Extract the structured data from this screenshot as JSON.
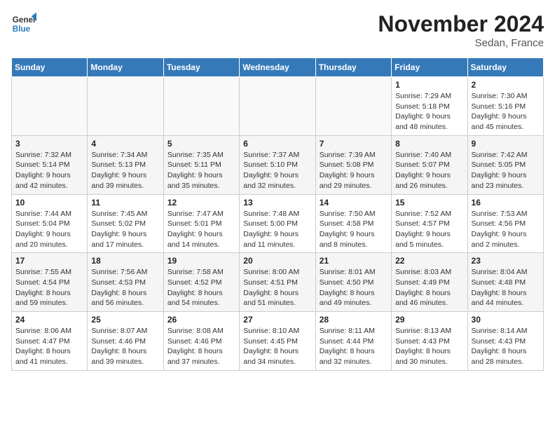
{
  "header": {
    "logo_general": "General",
    "logo_blue": "Blue",
    "month_title": "November 2024",
    "location": "Sedan, France"
  },
  "weekdays": [
    "Sunday",
    "Monday",
    "Tuesday",
    "Wednesday",
    "Thursday",
    "Friday",
    "Saturday"
  ],
  "weeks": [
    [
      {
        "day": "",
        "detail": ""
      },
      {
        "day": "",
        "detail": ""
      },
      {
        "day": "",
        "detail": ""
      },
      {
        "day": "",
        "detail": ""
      },
      {
        "day": "",
        "detail": ""
      },
      {
        "day": "1",
        "detail": "Sunrise: 7:29 AM\nSunset: 5:18 PM\nDaylight: 9 hours and 48 minutes."
      },
      {
        "day": "2",
        "detail": "Sunrise: 7:30 AM\nSunset: 5:16 PM\nDaylight: 9 hours and 45 minutes."
      }
    ],
    [
      {
        "day": "3",
        "detail": "Sunrise: 7:32 AM\nSunset: 5:14 PM\nDaylight: 9 hours and 42 minutes."
      },
      {
        "day": "4",
        "detail": "Sunrise: 7:34 AM\nSunset: 5:13 PM\nDaylight: 9 hours and 39 minutes."
      },
      {
        "day": "5",
        "detail": "Sunrise: 7:35 AM\nSunset: 5:11 PM\nDaylight: 9 hours and 35 minutes."
      },
      {
        "day": "6",
        "detail": "Sunrise: 7:37 AM\nSunset: 5:10 PM\nDaylight: 9 hours and 32 minutes."
      },
      {
        "day": "7",
        "detail": "Sunrise: 7:39 AM\nSunset: 5:08 PM\nDaylight: 9 hours and 29 minutes."
      },
      {
        "day": "8",
        "detail": "Sunrise: 7:40 AM\nSunset: 5:07 PM\nDaylight: 9 hours and 26 minutes."
      },
      {
        "day": "9",
        "detail": "Sunrise: 7:42 AM\nSunset: 5:05 PM\nDaylight: 9 hours and 23 minutes."
      }
    ],
    [
      {
        "day": "10",
        "detail": "Sunrise: 7:44 AM\nSunset: 5:04 PM\nDaylight: 9 hours and 20 minutes."
      },
      {
        "day": "11",
        "detail": "Sunrise: 7:45 AM\nSunset: 5:02 PM\nDaylight: 9 hours and 17 minutes."
      },
      {
        "day": "12",
        "detail": "Sunrise: 7:47 AM\nSunset: 5:01 PM\nDaylight: 9 hours and 14 minutes."
      },
      {
        "day": "13",
        "detail": "Sunrise: 7:48 AM\nSunset: 5:00 PM\nDaylight: 9 hours and 11 minutes."
      },
      {
        "day": "14",
        "detail": "Sunrise: 7:50 AM\nSunset: 4:58 PM\nDaylight: 9 hours and 8 minutes."
      },
      {
        "day": "15",
        "detail": "Sunrise: 7:52 AM\nSunset: 4:57 PM\nDaylight: 9 hours and 5 minutes."
      },
      {
        "day": "16",
        "detail": "Sunrise: 7:53 AM\nSunset: 4:56 PM\nDaylight: 9 hours and 2 minutes."
      }
    ],
    [
      {
        "day": "17",
        "detail": "Sunrise: 7:55 AM\nSunset: 4:54 PM\nDaylight: 8 hours and 59 minutes."
      },
      {
        "day": "18",
        "detail": "Sunrise: 7:56 AM\nSunset: 4:53 PM\nDaylight: 8 hours and 56 minutes."
      },
      {
        "day": "19",
        "detail": "Sunrise: 7:58 AM\nSunset: 4:52 PM\nDaylight: 8 hours and 54 minutes."
      },
      {
        "day": "20",
        "detail": "Sunrise: 8:00 AM\nSunset: 4:51 PM\nDaylight: 8 hours and 51 minutes."
      },
      {
        "day": "21",
        "detail": "Sunrise: 8:01 AM\nSunset: 4:50 PM\nDaylight: 8 hours and 49 minutes."
      },
      {
        "day": "22",
        "detail": "Sunrise: 8:03 AM\nSunset: 4:49 PM\nDaylight: 8 hours and 46 minutes."
      },
      {
        "day": "23",
        "detail": "Sunrise: 8:04 AM\nSunset: 4:48 PM\nDaylight: 8 hours and 44 minutes."
      }
    ],
    [
      {
        "day": "24",
        "detail": "Sunrise: 8:06 AM\nSunset: 4:47 PM\nDaylight: 8 hours and 41 minutes."
      },
      {
        "day": "25",
        "detail": "Sunrise: 8:07 AM\nSunset: 4:46 PM\nDaylight: 8 hours and 39 minutes."
      },
      {
        "day": "26",
        "detail": "Sunrise: 8:08 AM\nSunset: 4:46 PM\nDaylight: 8 hours and 37 minutes."
      },
      {
        "day": "27",
        "detail": "Sunrise: 8:10 AM\nSunset: 4:45 PM\nDaylight: 8 hours and 34 minutes."
      },
      {
        "day": "28",
        "detail": "Sunrise: 8:11 AM\nSunset: 4:44 PM\nDaylight: 8 hours and 32 minutes."
      },
      {
        "day": "29",
        "detail": "Sunrise: 8:13 AM\nSunset: 4:43 PM\nDaylight: 8 hours and 30 minutes."
      },
      {
        "day": "30",
        "detail": "Sunrise: 8:14 AM\nSunset: 4:43 PM\nDaylight: 8 hours and 28 minutes."
      }
    ]
  ]
}
